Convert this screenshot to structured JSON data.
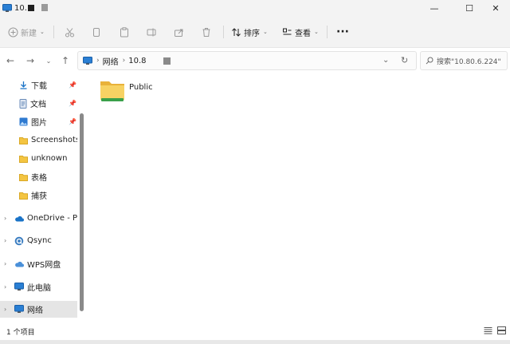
{
  "window": {
    "tab_title": "10.",
    "controls": {
      "minimize": "—",
      "maximize": "☐",
      "close": "✕"
    }
  },
  "toolbar": {
    "new_label": "新建",
    "sort_label": "排序",
    "view_label": "查看",
    "more_label": "···"
  },
  "address": {
    "crumbs": [
      "网络",
      "10.8"
    ],
    "search_placeholder": "搜索\"10.80.6.224\""
  },
  "sidebar": {
    "quick_access": [
      {
        "label": "下载",
        "icon": "download-icon",
        "pinned": true
      },
      {
        "label": "文档",
        "icon": "document-icon",
        "pinned": true
      },
      {
        "label": "图片",
        "icon": "picture-icon",
        "pinned": true
      },
      {
        "label": "Screenshots",
        "icon": "folder-icon",
        "pinned": false
      },
      {
        "label": "unknown",
        "icon": "folder-icon",
        "pinned": false
      },
      {
        "label": "表格",
        "icon": "folder-icon",
        "pinned": false
      },
      {
        "label": "捕获",
        "icon": "folder-icon",
        "pinned": false
      }
    ],
    "roots": [
      {
        "label": "OneDrive - Pers",
        "icon": "cloud-icon"
      },
      {
        "label": "Qsync",
        "icon": "qsync-icon"
      },
      {
        "label": "WPS网盘",
        "icon": "cloud-icon"
      },
      {
        "label": "此电脑",
        "icon": "computer-icon"
      },
      {
        "label": "网络",
        "icon": "network-icon",
        "selected": true
      }
    ]
  },
  "content": {
    "items": [
      {
        "name": "Public",
        "icon": "folder-shared-icon"
      }
    ]
  },
  "status": {
    "item_count": "1 个项目"
  },
  "colors": {
    "chrome_bg": "#f3f3f3",
    "selected_bg": "#e5e5e5",
    "folder_yellow": "#f4c542",
    "folder_green": "#3aa04a",
    "accent_blue": "#1a73c7"
  }
}
